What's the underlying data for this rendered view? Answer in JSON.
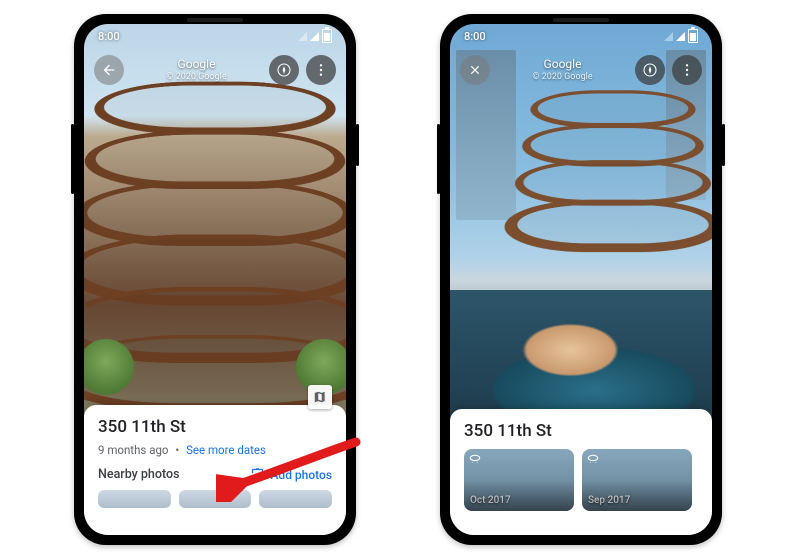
{
  "status": {
    "time": "8:00"
  },
  "header": {
    "title": "Google",
    "copyright": "© 2020 Google"
  },
  "left": {
    "address": "350 11th St",
    "age": "9 months ago",
    "see_more": "See more dates",
    "nearby_label": "Nearby photos",
    "add_photos": "Add photos"
  },
  "right": {
    "address": "350 11th St",
    "cards": [
      {
        "label": "Oct 2017"
      },
      {
        "label": "Sep 2017"
      },
      {
        "label": ""
      }
    ]
  }
}
